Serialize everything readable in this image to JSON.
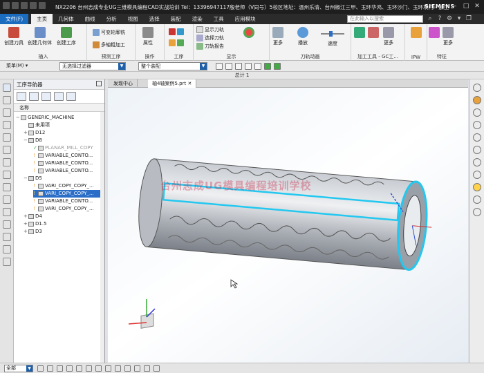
{
  "titlebar": {
    "title": "NX2206 台州志成专业UG三维模具编程CAD实战培训 Tel：13396947117殷老师（V同号）5校区地址：温州乐清、台州椒江三甲、玉环华鸿、玉环沙门、玉环坎门 - 加工",
    "brand": "SIEMENS"
  },
  "menu": {
    "file": "文件(F)",
    "items": [
      "主页",
      "几何体",
      "曲线",
      "分析",
      "视图",
      "选择",
      "装配",
      "渲染",
      "工具",
      "应用模块"
    ],
    "search_placeholder": "在此输入以搜索"
  },
  "ribbon": {
    "groups": [
      {
        "label": "插入",
        "buttons": [
          "创建刀具",
          "创建几何体",
          "创建工序"
        ]
      },
      {
        "label": "预测工序",
        "buttons": [
          "可变轮廓铣",
          "多轴粗加工"
        ]
      },
      {
        "label": "操作",
        "buttons": [
          "属性"
        ]
      },
      {
        "label": "工序",
        "buttons": []
      },
      {
        "label": "显示",
        "buttons": [
          "显示刀轨",
          "选择刀轨",
          "刀轨报告"
        ]
      },
      {
        "label": "刀轨动画",
        "buttons": [
          "更多",
          "播放",
          "速度"
        ]
      },
      {
        "label": "加工工具 - GC工...",
        "buttons": [
          "更多"
        ]
      },
      {
        "label": "IPW",
        "buttons": []
      },
      {
        "label": "特征",
        "buttons": [
          "更多"
        ]
      }
    ]
  },
  "toolbar2": {
    "menu": "菜单(M)",
    "filter": "无选择过滤器",
    "assembly": "整个装配"
  },
  "infobar": {
    "text": "总计 1"
  },
  "navigator": {
    "title": "工序导航器",
    "column": "名称",
    "nodes": [
      {
        "label": "GENERIC_MACHINE",
        "level": 0
      },
      {
        "label": "未用项",
        "level": 1
      },
      {
        "label": "D12",
        "level": 1
      },
      {
        "label": "D8",
        "level": 1
      },
      {
        "label": "PLANAR_MILL_COPY",
        "level": 2
      },
      {
        "label": "VARIABLE_CONTO...",
        "level": 2
      },
      {
        "label": "VARIABLE_CONTO...",
        "level": 2
      },
      {
        "label": "VARIABLE_CONTO...",
        "level": 2
      },
      {
        "label": "D5",
        "level": 1
      },
      {
        "label": "VARI_COPY_COPY_...",
        "level": 2
      },
      {
        "label": "VARI_COPY_COPY_...",
        "level": 2
      },
      {
        "label": "VARIABLE_CONTO...",
        "level": 2
      },
      {
        "label": "VARI_COPY_COPY_...",
        "level": 2
      },
      {
        "label": "D4",
        "level": 1
      },
      {
        "label": "D1.5",
        "level": 1
      },
      {
        "label": "D3",
        "level": 1
      }
    ]
  },
  "tabs": [
    "发现中心",
    "轴4轴案例5.prt"
  ],
  "watermark": "台州志成UG模具编程培训学校",
  "statusbar": {
    "select": "全部"
  },
  "colors": {
    "accent": "#1b6bbf",
    "selection": "#2a6ec8",
    "highlight": "#22c8f0"
  }
}
